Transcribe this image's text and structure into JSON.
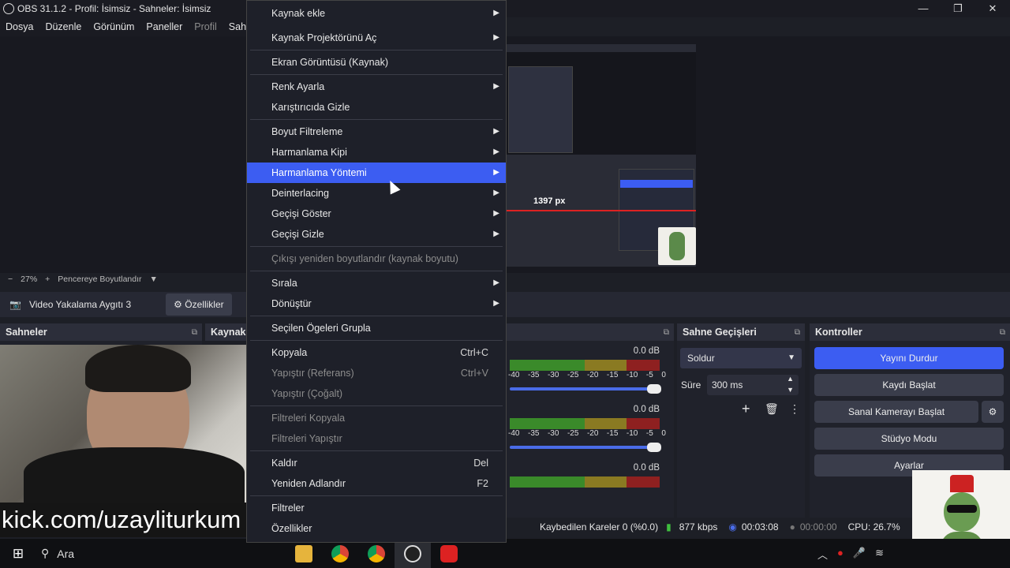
{
  "title_bar": {
    "title": "OBS 31.1.2 - Profil: İsimsiz - Sahneler: İsimsiz"
  },
  "menu_bar": {
    "items": [
      "Dosya",
      "Düzenle",
      "Görünüm",
      "Paneller",
      "Profil",
      "Sahn"
    ]
  },
  "preview": {
    "zoom": "27%",
    "fit_label": "Pencereye Boyutlandır",
    "measure": "1397 px"
  },
  "source_bar": {
    "source_name": "Video Yakalama Aygıtı 3",
    "properties_label": "Özellikler"
  },
  "docks": {
    "scenes": "Sahneler",
    "sources": "Kaynak",
    "transitions": "Sahne Geçişleri",
    "controls": "Kontroller"
  },
  "transitions": {
    "selected": "Soldur",
    "duration_label": "Süre",
    "duration_value": "300 ms"
  },
  "controls": {
    "stop_stream": "Yayını Durdur",
    "start_recording": "Kaydı Başlat",
    "start_virtual_cam": "Sanal Kamerayı Başlat",
    "studio_mode": "Stüdyo Modu",
    "settings": "Ayarlar"
  },
  "mixer": {
    "db_values": [
      "0.0 dB",
      "0.0 dB",
      "0.0 dB"
    ],
    "scale": [
      "-40",
      "-35",
      "-30",
      "-25",
      "-20",
      "-15",
      "-10",
      "-5",
      "0"
    ]
  },
  "context_menu": {
    "items": [
      {
        "label": "Kaynak ekle",
        "submenu": true
      },
      {
        "label": "Kaynak Projektörünü Aç",
        "submenu": true
      },
      {
        "label": "Ekran Görüntüsü (Kaynak)"
      },
      {
        "label": "Renk Ayarla",
        "submenu": true
      },
      {
        "label": "Karıştırıcıda Gizle"
      },
      {
        "label": "Boyut Filtreleme",
        "submenu": true
      },
      {
        "label": "Harmanlama Kipi",
        "submenu": true
      },
      {
        "label": "Harmanlama Yöntemi",
        "submenu": true,
        "highlighted": true
      },
      {
        "label": "Deinterlacing",
        "submenu": true
      },
      {
        "label": "Geçişi Göster",
        "submenu": true
      },
      {
        "label": "Geçişi Gizle",
        "submenu": true
      },
      {
        "label": "Çıkışı yeniden boyutlandır (kaynak boyutu)",
        "disabled": true
      },
      {
        "label": "Sırala",
        "submenu": true
      },
      {
        "label": "Dönüştür",
        "submenu": true
      },
      {
        "label": "Seçilen Ögeleri Grupla"
      },
      {
        "label": "Kopyala",
        "shortcut": "Ctrl+C"
      },
      {
        "label": "Yapıştır (Referans)",
        "shortcut": "Ctrl+V",
        "disabled": true
      },
      {
        "label": "Yapıştır (Çoğalt)",
        "disabled": true
      },
      {
        "label": "Filtreleri Kopyala",
        "disabled": true
      },
      {
        "label": "Filtreleri Yapıştır",
        "disabled": true
      },
      {
        "label": "Kaldır",
        "shortcut": "Del"
      },
      {
        "label": "Yeniden Adlandır",
        "shortcut": "F2"
      },
      {
        "label": "Filtreler"
      },
      {
        "label": "Özellikler"
      }
    ]
  },
  "status_bar": {
    "dropped_frames": "Kaybedilen Kareler 0 (%0.0)",
    "bitrate": "877 kbps",
    "stream_time": "00:03:08",
    "record_time": "00:00:00",
    "cpu": "CPU: 26.7%"
  },
  "overlay": {
    "kick_text": "kick.com/uzayliturkum"
  },
  "taskbar": {
    "search_label": "Ara"
  },
  "colors": {
    "accent": "#3c5df2",
    "bg": "#1d1f26"
  }
}
